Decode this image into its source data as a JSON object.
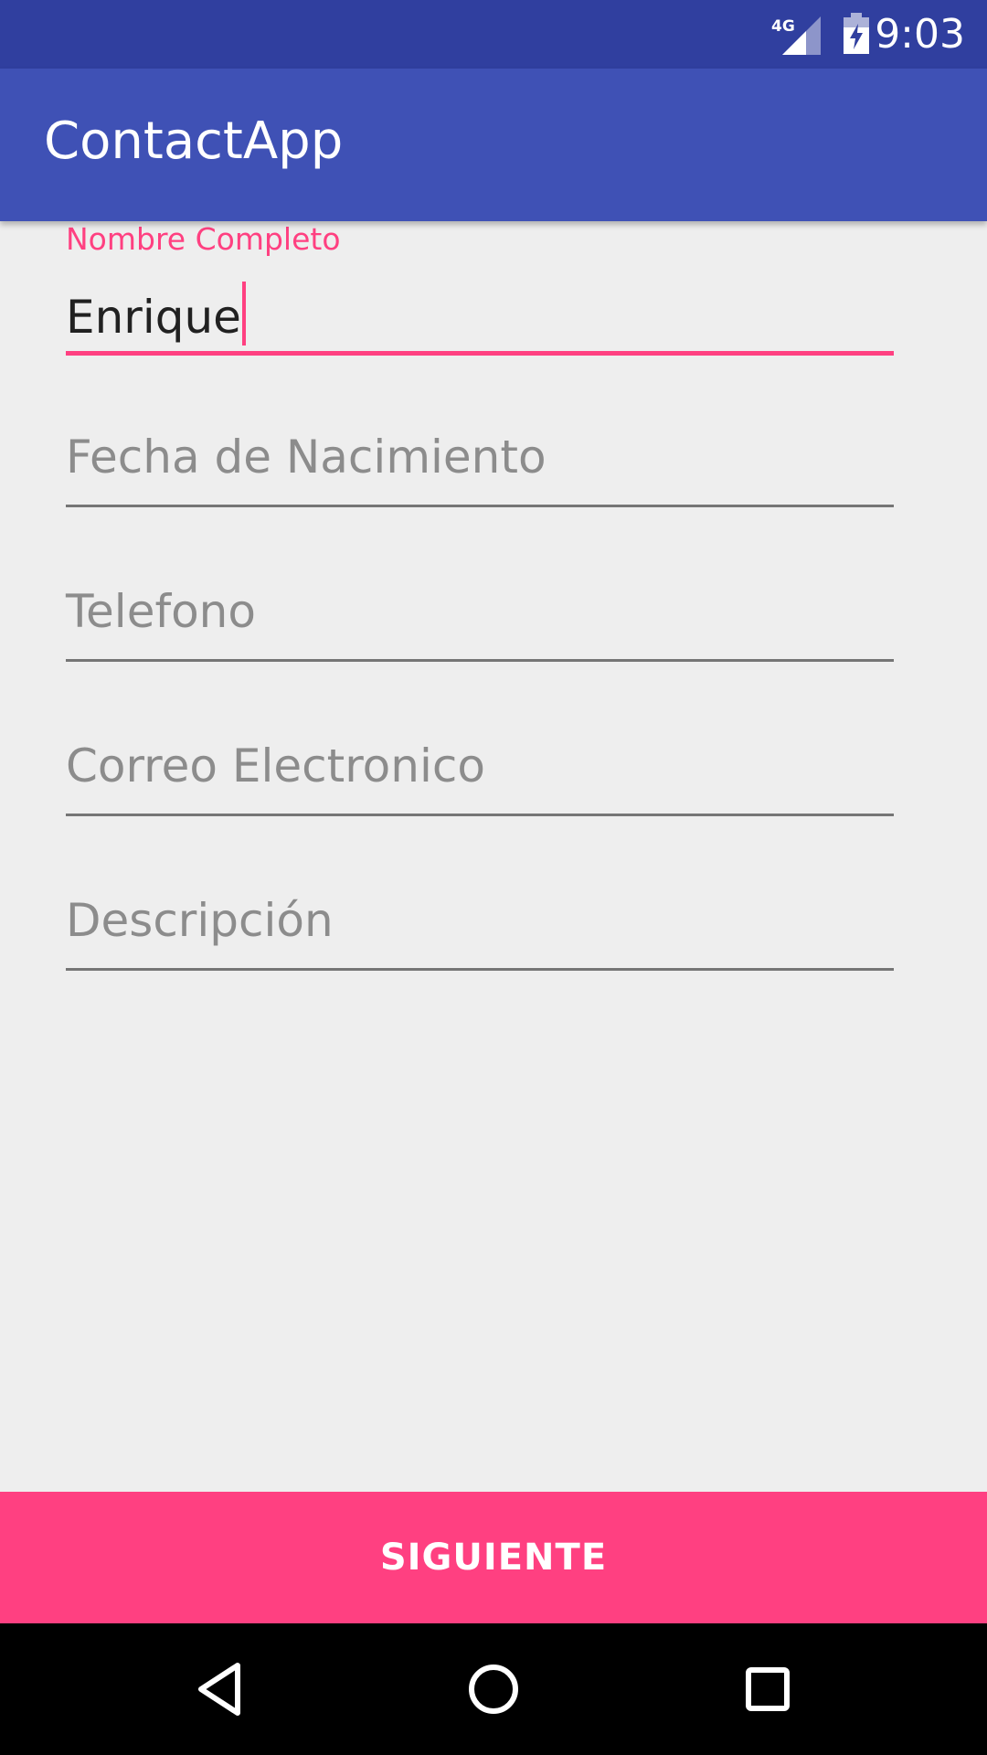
{
  "status_bar": {
    "time": "9:03",
    "network_label": "4G",
    "icons": [
      "cellular-signal-icon",
      "battery-charging-icon"
    ]
  },
  "app_bar": {
    "title": "ContactApp"
  },
  "form": {
    "fields": [
      {
        "id": "nombre",
        "label": "Nombre Completo",
        "value": "Enrique",
        "focused": true
      },
      {
        "id": "fecha",
        "placeholder": "Fecha de Nacimiento",
        "value": ""
      },
      {
        "id": "telefono",
        "placeholder": "Telefono",
        "value": ""
      },
      {
        "id": "correo",
        "placeholder": "Correo Electronico",
        "value": ""
      },
      {
        "id": "descripcion",
        "placeholder": "Descripción",
        "value": ""
      }
    ]
  },
  "actions": {
    "next_label": "SIGUIENTE"
  },
  "nav_bar": {
    "icons": [
      "back-icon",
      "home-icon",
      "recents-icon"
    ]
  },
  "colors": {
    "primary": "#3f51b5",
    "primary_dark": "#303f9f",
    "accent": "#ff4081",
    "background": "#eeeeee"
  }
}
